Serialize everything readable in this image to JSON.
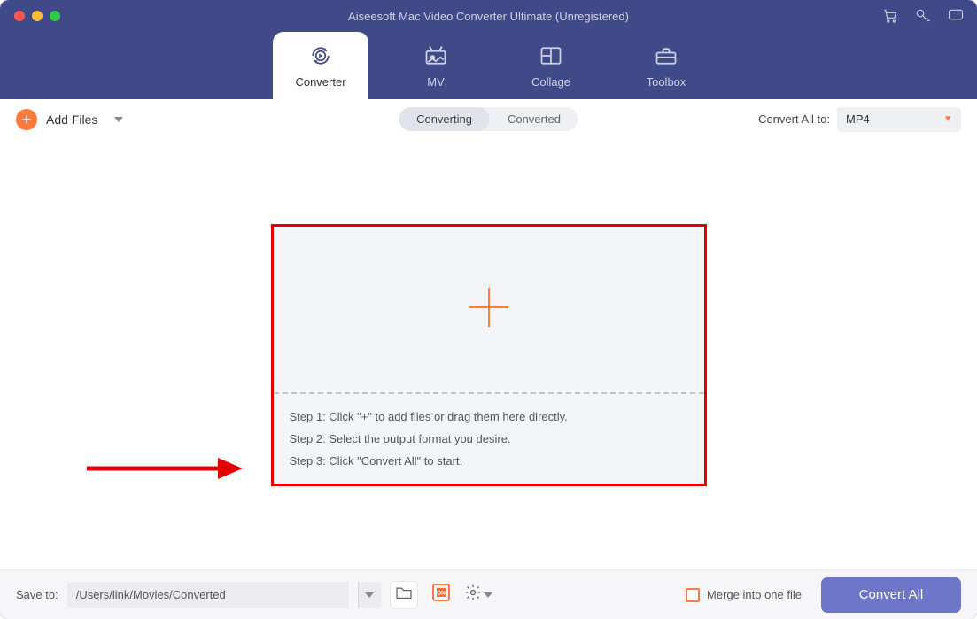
{
  "titlebar": {
    "title": "Aiseesoft Mac Video Converter Ultimate (Unregistered)"
  },
  "tabs": {
    "converter": "Converter",
    "mv": "MV",
    "collage": "Collage",
    "toolbox": "Toolbox"
  },
  "toolbar": {
    "add_files": "Add Files",
    "converting": "Converting",
    "converted": "Converted",
    "convert_all_to": "Convert All to:",
    "format": "MP4"
  },
  "dropzone": {
    "step1": "Step 1: Click \"+\" to add files or drag them here directly.",
    "step2": "Step 2: Select the output format you desire.",
    "step3": "Step 3: Click \"Convert All\" to start."
  },
  "bottom": {
    "save_to": "Save to:",
    "path": "/Users/link/Movies/Converted",
    "merge": "Merge into one file",
    "convert_all": "Convert All"
  },
  "colors": {
    "header_bg": "#404a88",
    "accent": "#ff7a3d",
    "primary_btn": "#6d76c8",
    "highlight_border": "#e30000"
  }
}
